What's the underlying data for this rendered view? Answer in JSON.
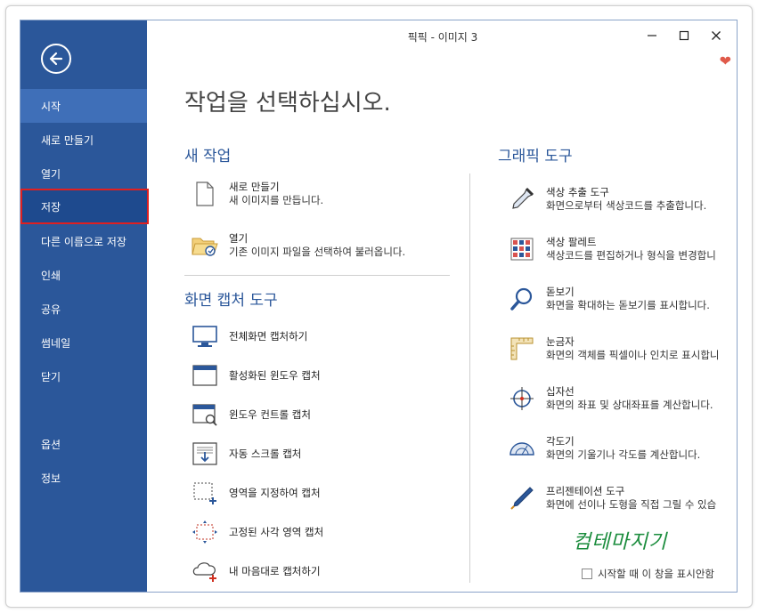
{
  "window": {
    "title": "픽픽 - 이미지 3",
    "heading": "작업을 선택하십시오."
  },
  "sidebar": {
    "items": [
      {
        "label": "시작"
      },
      {
        "label": "새로 만들기"
      },
      {
        "label": "열기"
      },
      {
        "label": "저장"
      },
      {
        "label": "다른 이름으로 저장"
      },
      {
        "label": "인쇄"
      },
      {
        "label": "공유"
      },
      {
        "label": "썸네일"
      },
      {
        "label": "닫기"
      },
      {
        "label": "옵션"
      },
      {
        "label": "정보"
      }
    ],
    "active_index": 0,
    "highlighted_index": 3
  },
  "new_task": {
    "title": "새 작업",
    "items": [
      {
        "title": "새로 만들기",
        "desc": "새 이미지를 만듭니다.",
        "icon": "new-file-icon"
      },
      {
        "title": "열기",
        "desc": "기존 이미지 파일을 선택하여 불러옵니다.",
        "icon": "open-folder-icon"
      }
    ]
  },
  "capture_tools": {
    "title": "화면 캡처 도구",
    "items": [
      {
        "label": "전체화면 캡처하기",
        "icon": "monitor-icon"
      },
      {
        "label": "활성화된 윈도우 캡처",
        "icon": "window-icon"
      },
      {
        "label": "윈도우 컨트롤 캡처",
        "icon": "window-control-icon"
      },
      {
        "label": "자동 스크롤 캡처",
        "icon": "scroll-capture-icon"
      },
      {
        "label": "영역을 지정하여 캡처",
        "icon": "region-capture-icon"
      },
      {
        "label": "고정된 사각 영역 캡처",
        "icon": "fixed-region-icon"
      },
      {
        "label": "내 마음대로 캡처하기",
        "icon": "freehand-capture-icon"
      }
    ]
  },
  "graphic_tools": {
    "title": "그래픽 도구",
    "items": [
      {
        "title": "색상 추출 도구",
        "desc": "화면으로부터 색상코드를 추출합니다.",
        "icon": "eyedropper-icon"
      },
      {
        "title": "색상 팔레트",
        "desc": "색상코드를 편집하거나 형식을 변경합니",
        "icon": "palette-icon"
      },
      {
        "title": "돋보기",
        "desc": "화면을 확대하는 돋보기를 표시합니다.",
        "icon": "magnifier-icon"
      },
      {
        "title": "눈금자",
        "desc": "화면의 객체를 픽셀이나 인치로 표시합니",
        "icon": "ruler-icon"
      },
      {
        "title": "십자선",
        "desc": "화면의 좌표 및 상대좌표를 계산합니다.",
        "icon": "crosshair-icon"
      },
      {
        "title": "각도기",
        "desc": "화면의 기울기나 각도를 계산합니다.",
        "icon": "protractor-icon"
      },
      {
        "title": "프리젠테이션 도구",
        "desc": "화면에 선이나 도형을 직접 그릴 수 있습",
        "icon": "pen-icon"
      }
    ]
  },
  "watermark": "컴테마지기",
  "startup_checkbox": {
    "label": "시작할 때 이 창을 표시안함",
    "checked": false
  },
  "colors": {
    "sidebar": "#2b579a",
    "sidebar_active": "#3f6fb8",
    "highlight_border": "#e02020",
    "accent": "#2b579a"
  }
}
